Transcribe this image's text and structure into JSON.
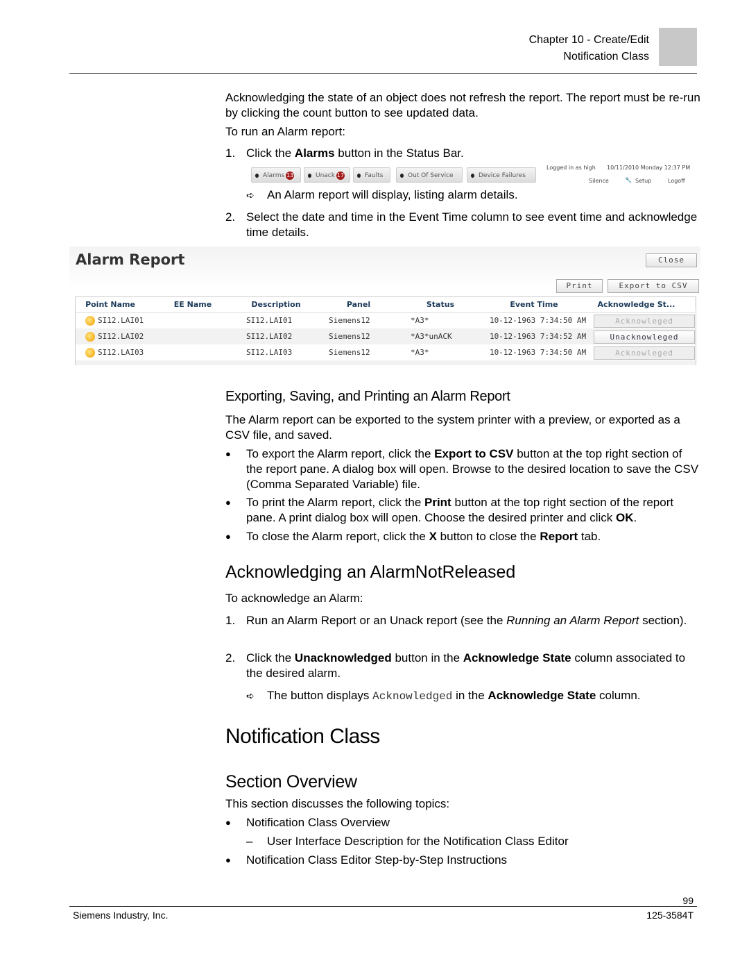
{
  "header": {
    "chapter": "Chapter 10 - Create/Edit",
    "section": "Notification Class"
  },
  "intro": [
    {
      "t": "Acknowledging the state of an object does not refresh the report. The report must be re-run by clicking the count button to see updated data."
    }
  ],
  "run_intro": [
    {
      "t": "To run an Alarm report:"
    }
  ],
  "step1": {
    "num": "1.",
    "segs": [
      {
        "t": "Click the "
      },
      {
        "t": "Alarms",
        "b": true
      },
      {
        "t": " button in the Status Bar."
      }
    ]
  },
  "status_bar": {
    "buttons": [
      {
        "label": "Alarms",
        "count": "13"
      },
      {
        "label": "Unack",
        "count": "17"
      },
      {
        "label": "Faults"
      },
      {
        "label": "Out Of Service"
      },
      {
        "label": "Device Failures"
      }
    ],
    "logged_in": "Logged in as high",
    "datetime": "10/11/2010 Monday 12:37 PM",
    "silence": "Silence",
    "setup": "Setup",
    "logoff": "Logoff"
  },
  "result1": [
    {
      "t": "An Alarm report will display, listing alarm details."
    }
  ],
  "step2": {
    "num": "2.",
    "segs": [
      {
        "t": "Select the date and time in the Event Time column to see event time and acknowledge time details."
      }
    ]
  },
  "alarm_report": {
    "title": "Alarm Report",
    "close": "Close",
    "print": "Print",
    "export": "Export to CSV",
    "columns": [
      "Point Name",
      "EE Name",
      "Description",
      "Panel",
      "Status",
      "Event Time",
      "Acknowledge St..."
    ],
    "rows": [
      {
        "point": "SI12.LAI01",
        "ee": "",
        "desc": "SI12.LAI01",
        "panel": "Siemens12",
        "status": "*A3*",
        "time": "10-12-1963 7:34:50 AM",
        "ack": "Acknowleged",
        "acked": true
      },
      {
        "point": "SI12.LAI02",
        "ee": "",
        "desc": "SI12.LAI02",
        "panel": "Siemens12",
        "status": "*A3*unACK",
        "time": "10-12-1963 7:34:52 AM",
        "ack": "Unacknowleged",
        "acked": false
      },
      {
        "point": "SI12.LAI03",
        "ee": "",
        "desc": "SI12.LAI03",
        "panel": "Siemens12",
        "status": "*A3*",
        "time": "10-12-1963 7:34:50 AM",
        "ack": "Acknowleged",
        "acked": true
      }
    ]
  },
  "export_heading": "Exporting, Saving, and Printing an Alarm Report",
  "export_para": [
    {
      "t": "The Alarm report can be exported to the system printer with a preview, or exported as a CSV file, and saved."
    }
  ],
  "export_bullets": [
    [
      {
        "t": "To export the Alarm report, click the "
      },
      {
        "t": "Export to CSV",
        "b": true
      },
      {
        "t": " button at the top right section of the report pane. A dialog box will open. Browse to the desired location to save the CSV (Comma Separated Variable) file."
      }
    ],
    [
      {
        "t": "To print the Alarm report, click the "
      },
      {
        "t": "Print",
        "b": true
      },
      {
        "t": " button at the top right section of the report pane. A print dialog box will open. Choose the desired printer and click "
      },
      {
        "t": "OK",
        "b": true
      },
      {
        "t": "."
      }
    ],
    [
      {
        "t": "To close the Alarm report, click the "
      },
      {
        "t": "X",
        "b": true
      },
      {
        "t": " button to close the "
      },
      {
        "t": "Report",
        "b": true
      },
      {
        "t": " tab."
      }
    ]
  ],
  "ack_heading": "Acknowledging an AlarmNotReleased",
  "ack_intro": [
    {
      "t": "To acknowledge an Alarm:"
    }
  ],
  "ack_step1": {
    "num": "1.",
    "segs": [
      {
        "t": "Run an Alarm Report or an Unack report (see the "
      },
      {
        "t": "Running an Alarm Report",
        "i": true
      },
      {
        "t": " section)."
      }
    ]
  },
  "ack_step2": {
    "num": "2.",
    "segs": [
      {
        "t": "Click the "
      },
      {
        "t": "Unacknowledged",
        "b": true
      },
      {
        "t": " button in the "
      },
      {
        "t": "Acknowledge State",
        "b": true
      },
      {
        "t": " column associated to the desired alarm."
      }
    ]
  },
  "ack_result": [
    {
      "t": "The button displays "
    },
    {
      "t": "Acknowledged",
      "m": true
    },
    {
      "t": " in the "
    },
    {
      "t": "Acknowledge State",
      "b": true
    },
    {
      "t": " column."
    }
  ],
  "nc_heading": "Notification Class",
  "so_heading": "Section Overview",
  "so_intro": [
    {
      "t": "This section discusses the following topics:"
    }
  ],
  "so_items": [
    [
      {
        "t": "Notification Class Overview"
      }
    ],
    [
      {
        "t": "User Interface Description for the Notification Class Editor"
      }
    ],
    [
      {
        "t": "Notification Class Editor Step-by-Step Instructions"
      }
    ]
  ],
  "footer": {
    "page": "99",
    "company": "Siemens Industry, Inc.",
    "doc": "125-3584T"
  },
  "markers": {
    "bullet": "●",
    "arrow": "➪",
    "dash": "–"
  }
}
